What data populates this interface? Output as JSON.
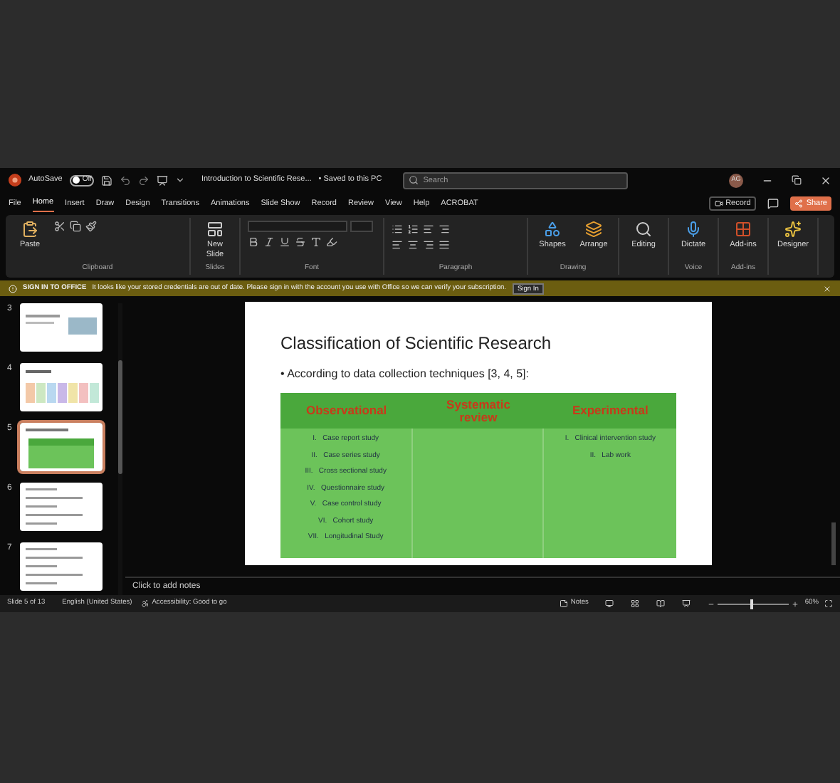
{
  "title_bar": {
    "autosave_label": "AutoSave",
    "autosave_state": "Off",
    "autosave_on": false,
    "document_title": "Introduction to Scientific Rese...",
    "save_status": "• Saved to this PC",
    "search": {
      "placeholder": "Search"
    },
    "user_initials": "AG"
  },
  "menu_tabs": [
    {
      "label": "File",
      "selected": false
    },
    {
      "label": "Home",
      "selected": true
    },
    {
      "label": "Insert",
      "selected": false
    },
    {
      "label": "Draw",
      "selected": false
    },
    {
      "label": "Design",
      "selected": false
    },
    {
      "label": "Transitions",
      "selected": false
    },
    {
      "label": "Animations",
      "selected": false
    },
    {
      "label": "Slide Show",
      "selected": false
    },
    {
      "label": "Record",
      "selected": false
    },
    {
      "label": "Review",
      "selected": false
    },
    {
      "label": "View",
      "selected": false
    },
    {
      "label": "Help",
      "selected": false
    },
    {
      "label": "ACROBAT",
      "selected": false
    }
  ],
  "record_button": "Record",
  "share_button": "Share",
  "ribbon": [
    {
      "label": "Clipboard",
      "buttons": [
        {
          "label": "Paste",
          "kind": "paste"
        }
      ]
    },
    {
      "label": "Slides",
      "buttons": [
        {
          "label": "New Slide",
          "kind": "slide"
        }
      ]
    },
    {
      "label": "Font",
      "kind": "font"
    },
    {
      "label": "Paragraph",
      "kind": "paragraph"
    },
    {
      "label": "Drawing",
      "buttons": [
        {
          "label": "Shapes",
          "kind": "shapes"
        },
        {
          "label": "Arrange",
          "kind": "arrange"
        }
      ]
    },
    {
      "buttons": [
        {
          "label": "Editing",
          "kind": "search"
        }
      ]
    },
    {
      "label": "Voice",
      "buttons": [
        {
          "label": "Dictate",
          "kind": "mic"
        }
      ]
    },
    {
      "label": "Add-ins",
      "buttons": [
        {
          "label": "Add-ins",
          "kind": "grid"
        }
      ]
    },
    {
      "buttons": [
        {
          "label": "Designer",
          "kind": "designer"
        }
      ]
    }
  ],
  "banner": {
    "heading": "SIGN IN TO OFFICE",
    "message": "It looks like your stored credentials are out of date. Please sign in with the account you use with Office so we can verify your subscription.",
    "button": "Sign In"
  },
  "slides": [
    {
      "number": "3",
      "selected": false,
      "kind": "image"
    },
    {
      "number": "4",
      "selected": false,
      "kind": "columns"
    },
    {
      "number": "5",
      "selected": true,
      "kind": "table"
    },
    {
      "number": "6",
      "selected": false,
      "kind": "text"
    },
    {
      "number": "7",
      "selected": false,
      "kind": "text"
    }
  ],
  "slide": {
    "title": "Classification of Scientific Research",
    "bullet_mark": "•",
    "bullet": "According to data collection techniques [3, 4, 5]:",
    "table": {
      "headers": [
        "Observational",
        "Systematic review",
        "Experimental"
      ],
      "columns": [
        [
          {
            "numeral": "I.",
            "text": "Case report study"
          },
          {
            "numeral": "II.",
            "text": "Case series study"
          },
          {
            "numeral": "III.",
            "text": "Cross sectional study"
          },
          {
            "numeral": "IV.",
            "text": "Questionnaire study"
          },
          {
            "numeral": "V.",
            "text": "Case control study"
          },
          {
            "numeral": "VI.",
            "text": "Cohort study"
          },
          {
            "numeral": "VII.",
            "text": "Longitudinal Study"
          }
        ],
        [],
        [
          {
            "numeral": "I.",
            "text": "Clinical intervention study"
          },
          {
            "numeral": "II.",
            "text": "Lab work"
          }
        ]
      ]
    }
  },
  "notes_placeholder": "Click to add notes",
  "status_bar": {
    "slide_count": "Slide 5 of 13",
    "language": "English (United States)",
    "accessibility": "Accessibility: Good to go",
    "notes": "Notes",
    "zoom": "60%",
    "zoom_slider": {
      "level": 0.45
    }
  }
}
